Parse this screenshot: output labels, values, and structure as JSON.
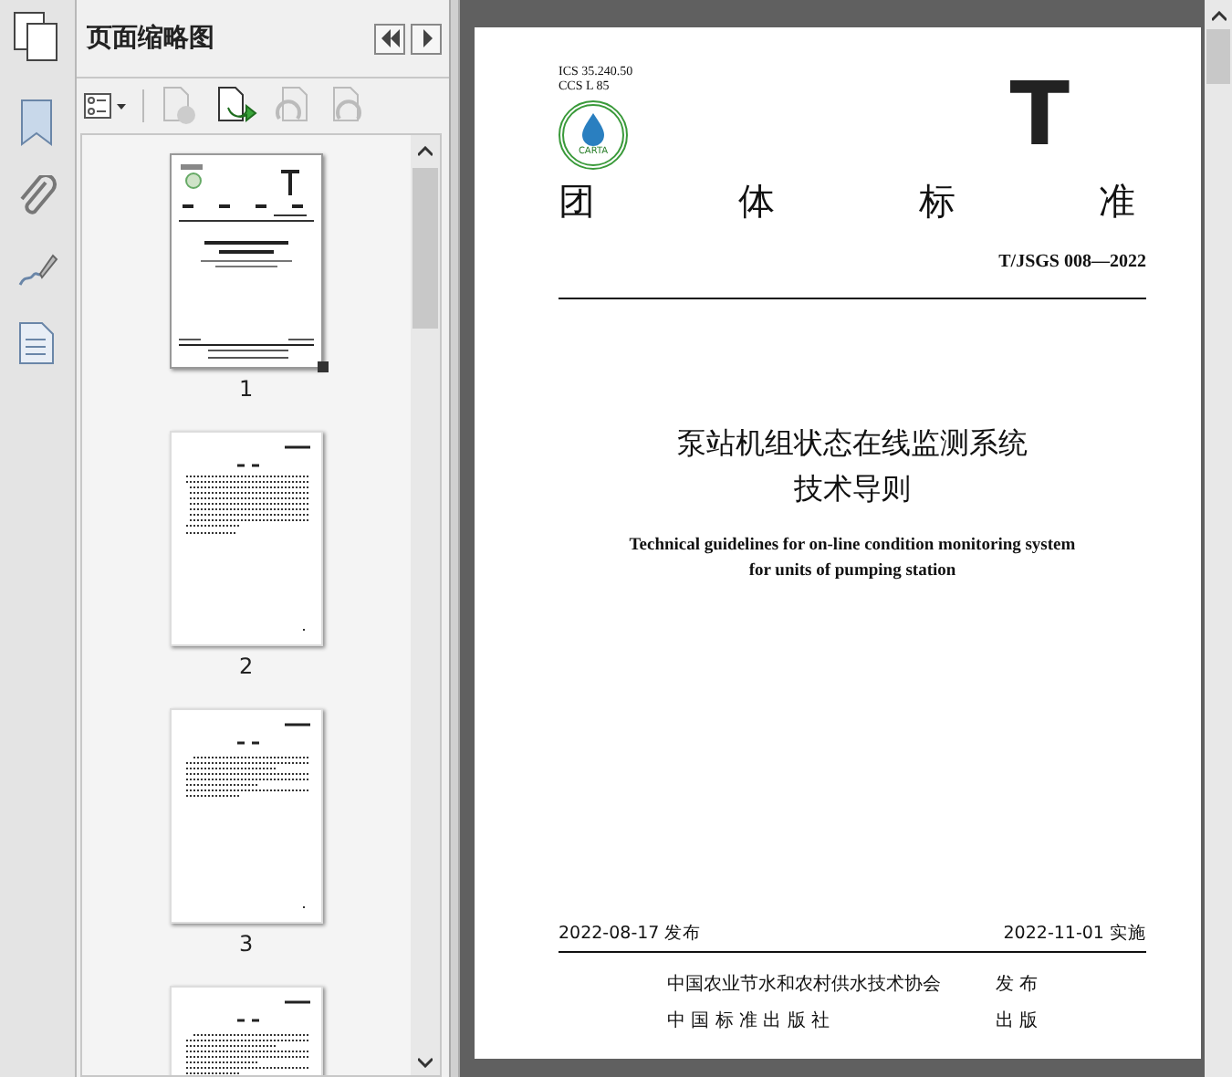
{
  "panel": {
    "title": "页面缩略图"
  },
  "thumbnails": [
    {
      "page": "1",
      "selected": true,
      "kind": "cover"
    },
    {
      "page": "2",
      "selected": false,
      "kind": "contents"
    },
    {
      "page": "3",
      "selected": false,
      "kind": "text"
    },
    {
      "selected": false,
      "kind": "text"
    }
  ],
  "document": {
    "ics": "ICS 35.240.50",
    "ccs": "CCS L 85",
    "logo_text": "CARTA",
    "mark": "T",
    "heading": [
      "团",
      "体",
      "标",
      "准"
    ],
    "code": "T/JSGS 008—2022",
    "title_lines": [
      "泵站机组状态在线监测系统",
      "技术导则"
    ],
    "english_lines": [
      "Technical guidelines for on-line condition monitoring system",
      "for units of pumping station"
    ],
    "issue_date": "2022-08-17 发布",
    "effective_date": "2022-11-01 实施",
    "publishers": [
      {
        "name": "中国农业节水和农村供水技术协会",
        "role": "发 布"
      },
      {
        "name": "中 国 标 准 出 版 社",
        "role": "出 版"
      }
    ]
  }
}
